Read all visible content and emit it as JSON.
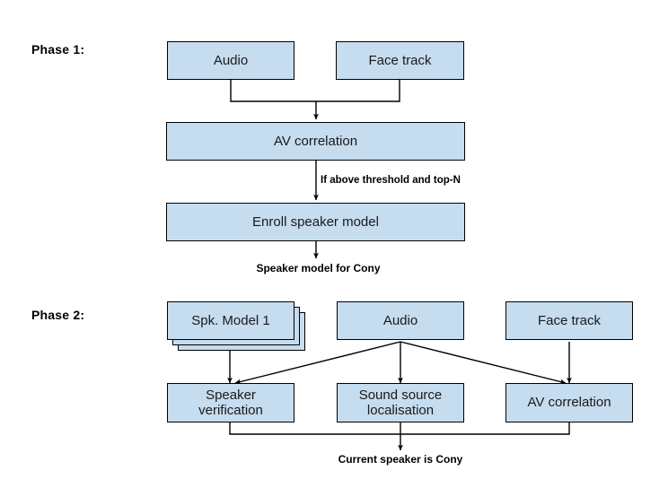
{
  "diagram": {
    "title_phase1": "Phase 1:",
    "title_phase2": "Phase 2:",
    "box_fill": "#c6dcef",
    "box_stroke": "#000000",
    "background": "#ffffff"
  },
  "phase1": {
    "label": "Phase 1:",
    "nodes": {
      "audio": "Audio",
      "face_track": "Face track",
      "av_correlation": "AV correlation",
      "enroll": "Enroll speaker model"
    },
    "edge_labels": {
      "threshold": "If above threshold and top-N"
    },
    "output": "Speaker model for Cony"
  },
  "phase2": {
    "label": "Phase 2:",
    "nodes": {
      "spk_model": "Spk. Model 1",
      "audio": "Audio",
      "face_track": "Face track",
      "speaker_verification_line1": "Speaker",
      "speaker_verification_line2": "verification",
      "sound_source_line1": "Sound source",
      "sound_source_line2": "localisation",
      "av_correlation": "AV correlation"
    },
    "output": "Current speaker is Cony"
  }
}
